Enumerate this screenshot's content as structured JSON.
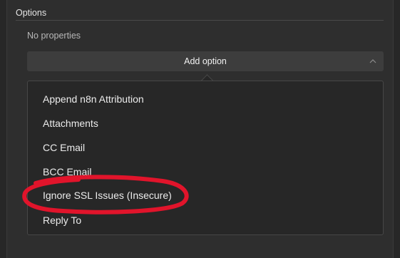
{
  "section": {
    "title": "Options",
    "empty_text": "No properties"
  },
  "add_option": {
    "label": "Add option",
    "icon": "chevron-up-icon"
  },
  "menu": {
    "items": [
      {
        "label": "Append n8n Attribution"
      },
      {
        "label": "Attachments"
      },
      {
        "label": "CC Email"
      },
      {
        "label": "BCC Email"
      },
      {
        "label": "Ignore SSL Issues (Insecure)"
      },
      {
        "label": "Reply To"
      }
    ]
  },
  "colors": {
    "background": "#2e2e2e",
    "annotation": "#e1142b"
  }
}
